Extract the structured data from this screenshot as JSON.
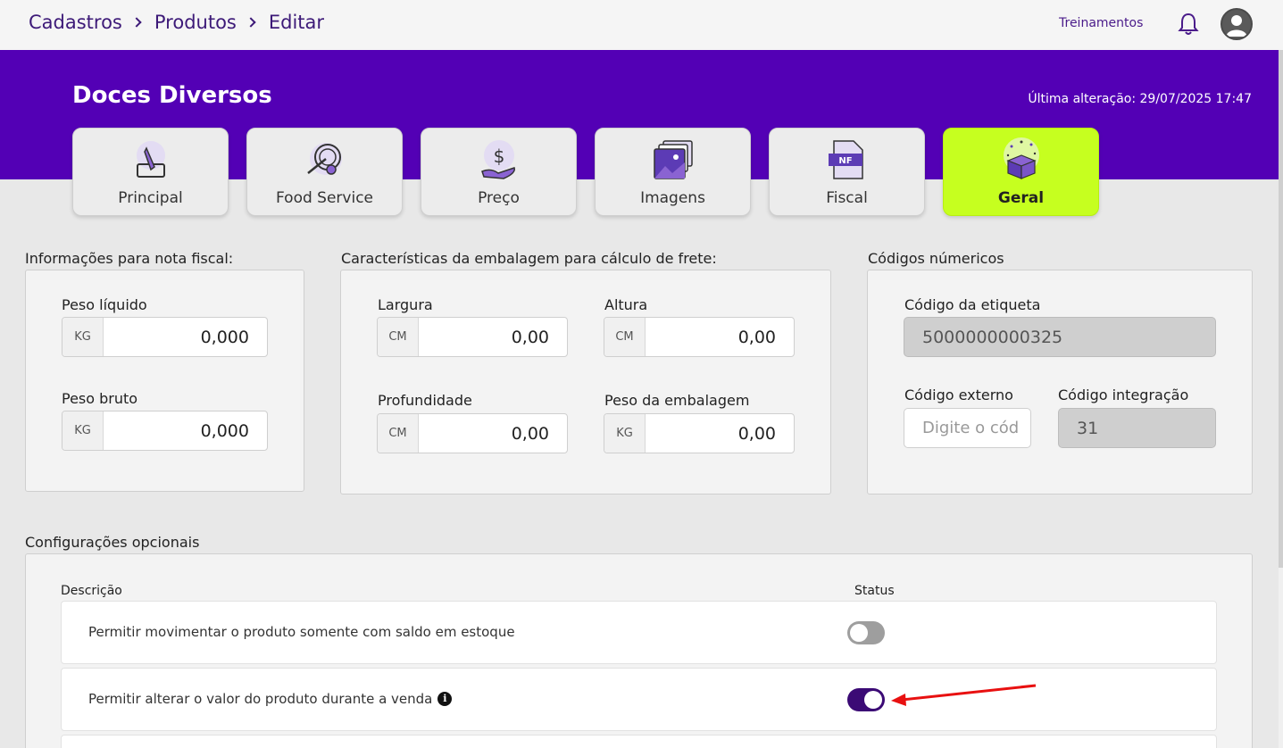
{
  "breadcrumb": [
    "Cadastros",
    "Produtos",
    "Editar"
  ],
  "header": {
    "training_link": "Treinamentos",
    "bell_icon": "bell-icon",
    "avatar_icon": "user-avatar-icon"
  },
  "product": {
    "name": "Doces Diversos",
    "last_change": "Última alteração: 29/07/2025 17:47"
  },
  "tabs": [
    {
      "label": "Principal",
      "icon": "pencil-edit-icon",
      "active": false
    },
    {
      "label": "Food Service",
      "icon": "plate-fork-gear-icon",
      "active": false
    },
    {
      "label": "Preço",
      "icon": "dollar-hand-icon",
      "active": false
    },
    {
      "label": "Imagens",
      "icon": "images-icon",
      "active": false
    },
    {
      "label": "Fiscal",
      "icon": "nf-document-icon",
      "active": false
    },
    {
      "label": "Geral",
      "icon": "open-box-icon",
      "active": true
    }
  ],
  "fiscal_info": {
    "title": "Informações para nota fiscal:",
    "peso_liquido": {
      "label": "Peso líquido",
      "unit": "KG",
      "value": "0,000"
    },
    "peso_bruto": {
      "label": "Peso bruto",
      "unit": "KG",
      "value": "0,000"
    }
  },
  "packaging": {
    "title": "Características da embalagem para cálculo de frete:",
    "largura": {
      "label": "Largura",
      "unit": "CM",
      "value": "0,00"
    },
    "altura": {
      "label": "Altura",
      "unit": "CM",
      "value": "0,00"
    },
    "profundidade": {
      "label": "Profundidade",
      "unit": "CM",
      "value": "0,00"
    },
    "peso_embalagem": {
      "label": "Peso da embalagem",
      "unit": "KG",
      "value": "0,00"
    }
  },
  "codes": {
    "title": "Códigos númericos",
    "etiqueta": {
      "label": "Código da etiqueta",
      "value": "5000000000325"
    },
    "externo": {
      "label": "Código externo",
      "placeholder": "Digite o cód"
    },
    "integracao": {
      "label": "Código integração",
      "value": "31"
    }
  },
  "optional": {
    "title": "Configurações opcionais",
    "col_desc": "Descrição",
    "col_status": "Status",
    "rows": [
      {
        "text": "Permitir movimentar o produto somente com saldo em estoque",
        "status": false
      },
      {
        "text": "Permitir alterar o valor do produto durante a venda",
        "status": true,
        "info_icon": "i"
      }
    ]
  },
  "colors": {
    "primary": "#5300b5",
    "accent": "#c6ff1f",
    "toggle_on": "#3b0a75",
    "annotation_arrow": "#e81010"
  }
}
